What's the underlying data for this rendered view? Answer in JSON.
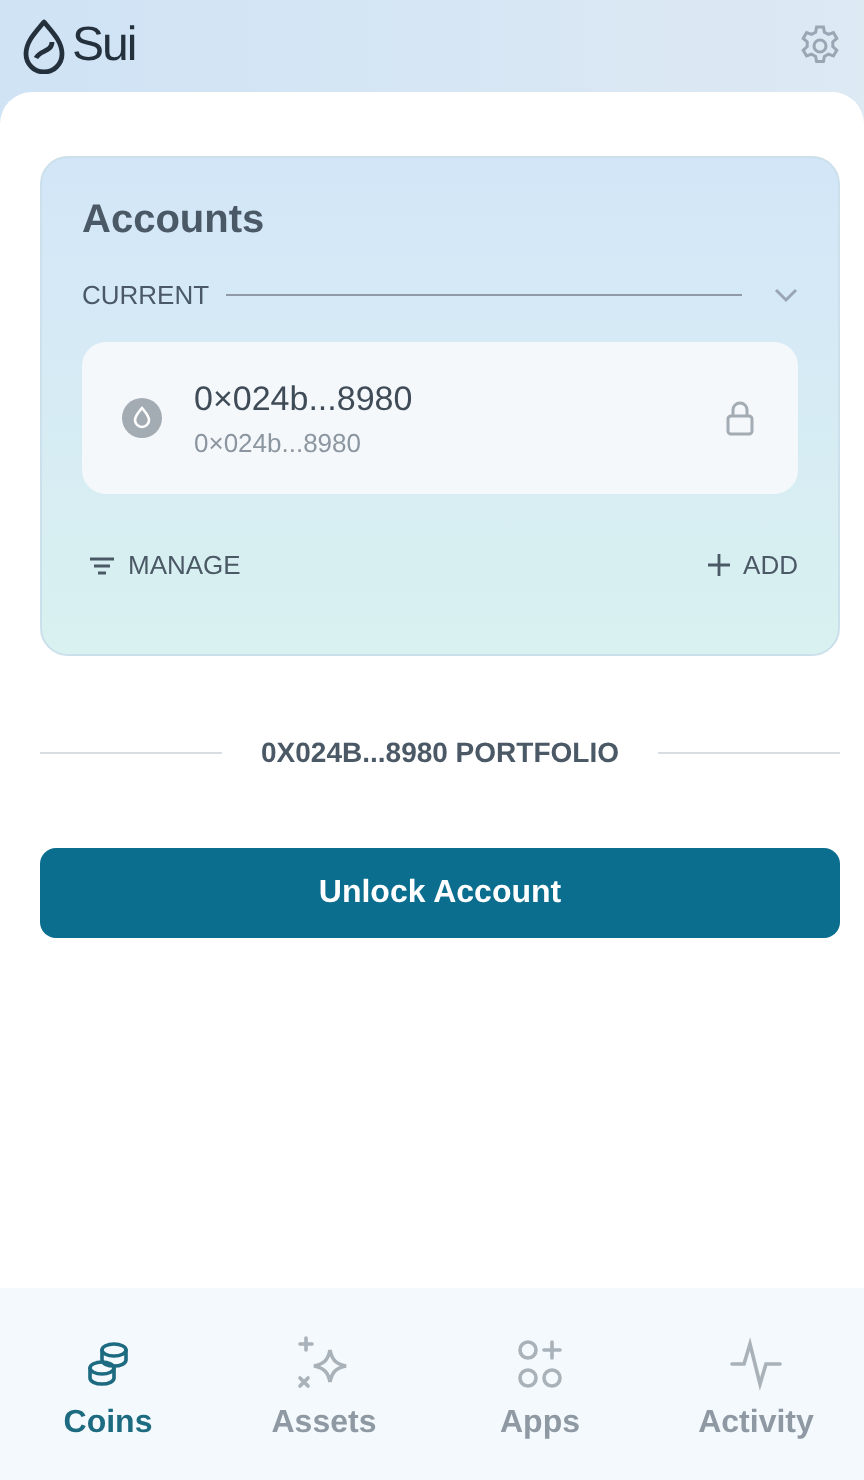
{
  "header": {
    "logo": "Sui"
  },
  "accounts": {
    "title": "Accounts",
    "section": "CURRENT",
    "items": [
      {
        "name": "0×024b...8980",
        "address": "0×024b...8980",
        "locked": true
      }
    ],
    "actions": [
      {
        "kind": "manage",
        "label": "MANAGE"
      },
      {
        "kind": "add",
        "label": "ADD"
      }
    ]
  },
  "portfolio": {
    "label": "0X024B...8980 PORTFOLIO"
  },
  "unlock_button": "Unlock Account",
  "nav": [
    {
      "kind": "coins",
      "label": "Coins",
      "selected": true
    },
    {
      "kind": "assets",
      "label": "Assets",
      "selected": false
    },
    {
      "kind": "apps",
      "label": "Apps",
      "selected": false
    },
    {
      "kind": "activity",
      "label": "Activity",
      "selected": false
    }
  ]
}
